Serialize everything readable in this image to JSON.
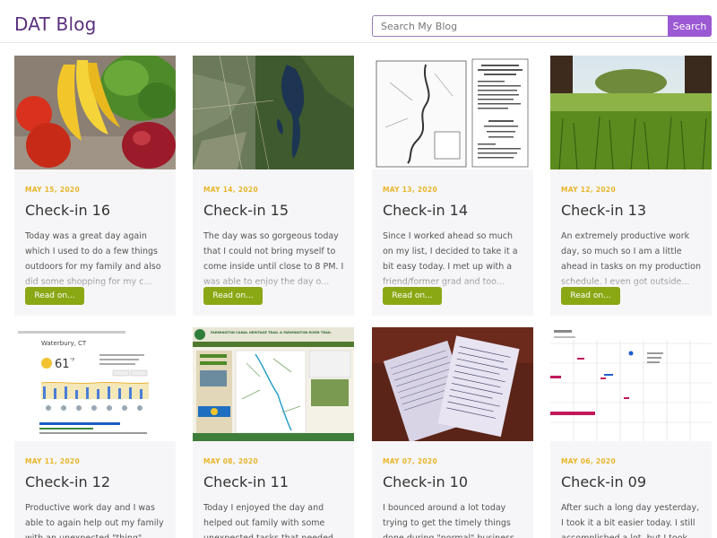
{
  "site": {
    "title": "DAT Blog"
  },
  "search": {
    "placeholder": "Search My Blog",
    "button_label": "Search"
  },
  "read_more_label": "Read on...",
  "posts": [
    {
      "date": "MAY 15, 2020",
      "title": "Check-in 16",
      "excerpt": "Today was a great day again which I used to do a few things outdoors for my family and also did some shopping for my c..."
    },
    {
      "date": "MAY 14, 2020",
      "title": "Check-in 15",
      "excerpt": "The day was so gorgeous today that I could not bring myself to come inside until close to 8 PM. I was able to enjoy the day o..."
    },
    {
      "date": "MAY 13, 2020",
      "title": "Check-in 14",
      "excerpt": "Since I worked ahead so much on my list, I decided to take it a bit easy today. I met up with a friend/former grad and too..."
    },
    {
      "date": "MAY 12, 2020",
      "title": "Check-in 13",
      "excerpt": "An extremely productive work day, so much so I am a little ahead in tasks on my production schedule. I even got outside..."
    },
    {
      "date": "MAY 11, 2020",
      "title": "Check-in 12",
      "excerpt": "Productive work day and I was able to again help out my family with an unexpected \"thing\" that..."
    },
    {
      "date": "MAY 08, 2020",
      "title": "Check-in 11",
      "excerpt": "Today I enjoyed the day and helped out family with some unexpected tasks that needed to..."
    },
    {
      "date": "MAY 07, 2020",
      "title": "Check-in 10",
      "excerpt": "I bounced around a lot today trying to get the timely things done during \"normal\" business..."
    },
    {
      "date": "MAY 06, 2020",
      "title": "Check-in 09",
      "excerpt": "After such a long day yesterday, I took it a bit easier today. I still accomplished a lot, but I took a..."
    }
  ],
  "weather_widget": {
    "city": "Waterbury, CT",
    "temp": "61",
    "temp_unit": "°F"
  },
  "trail_banner": {
    "heading": "FARMINGTON CANAL HERITAGE TRAIL & FARMINGTON RIVER TRAIL"
  }
}
